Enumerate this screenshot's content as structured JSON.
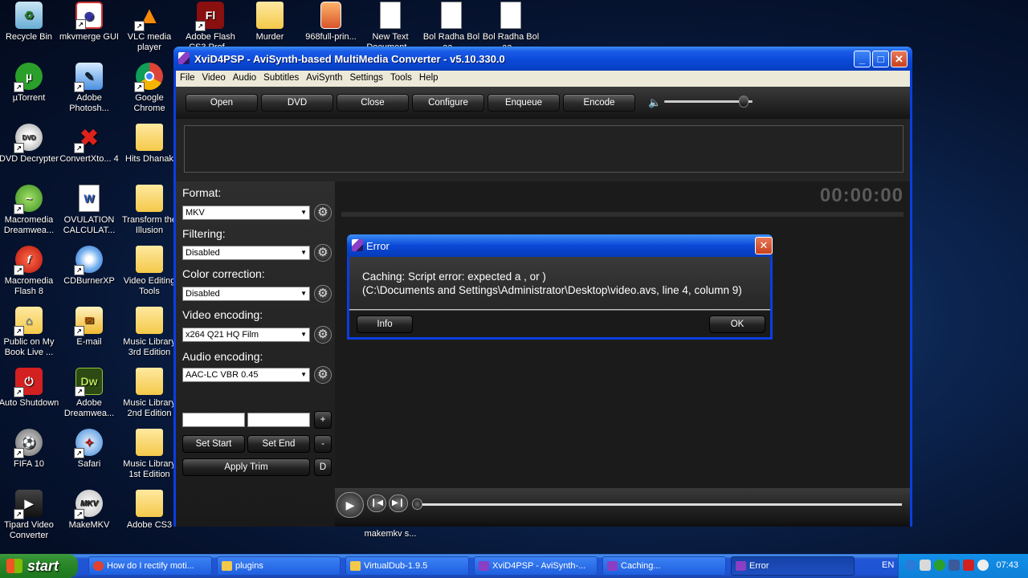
{
  "desktop": {
    "icons": [
      {
        "label": "Recycle Bin",
        "icon": "recycle-bin-icon"
      },
      {
        "label": "mkvmerge GUI",
        "icon": "mkvmerge-icon"
      },
      {
        "label": "VLC media player",
        "icon": "vlc-icon"
      },
      {
        "label": "Adobe Flash CS3 Prof...",
        "icon": "flash-icon"
      },
      {
        "label": "Murder",
        "icon": "folder-icon"
      },
      {
        "label": "968full-prin...",
        "icon": "image-file-icon"
      },
      {
        "label": "New Text Document...",
        "icon": "text-file-icon"
      },
      {
        "label": "Bol Radha Bol aa...",
        "icon": "text-file-icon"
      },
      {
        "label": "Bol Radha Bol aa...",
        "icon": "text-file-icon"
      },
      {
        "label": "µTorrent",
        "icon": "utorrent-icon"
      },
      {
        "label": "Adobe Photosh...",
        "icon": "photoshop-icon"
      },
      {
        "label": "Google Chrome",
        "icon": "chrome-icon"
      },
      {
        "label": "DVD Decrypter",
        "icon": "dvd-icon"
      },
      {
        "label": "ConvertXto... 4",
        "icon": "convertx-icon"
      },
      {
        "label": "Hits Dhanak",
        "icon": "folder-icon"
      },
      {
        "label": "Macromedia Dreamwea...",
        "icon": "dreamweaver-icon"
      },
      {
        "label": "OVULATION CALCULAT...",
        "icon": "word-doc-icon"
      },
      {
        "label": "Transform the Illusion",
        "icon": "folder-icon"
      },
      {
        "label": "Macromedia Flash 8",
        "icon": "flash8-icon"
      },
      {
        "label": "CDBurnerXP",
        "icon": "cdburner-icon"
      },
      {
        "label": "Video Editing Tools",
        "icon": "folder-icon"
      },
      {
        "label": "Public on My Book Live ...",
        "icon": "network-folder-icon"
      },
      {
        "label": "E-mail",
        "icon": "email-icon"
      },
      {
        "label": "Music Library 3rd Edition",
        "icon": "folder-icon"
      },
      {
        "label": "Auto Shutdown",
        "icon": "shutdown-icon"
      },
      {
        "label": "Adobe Dreamwea...",
        "icon": "dw-icon"
      },
      {
        "label": "Music Library 2nd Edition",
        "icon": "folder-icon"
      },
      {
        "label": "FIFA 10",
        "icon": "fifa-icon"
      },
      {
        "label": "Safari",
        "icon": "safari-icon"
      },
      {
        "label": "Music Library 1st Edition",
        "icon": "folder-icon"
      },
      {
        "label": "Tipard Video Converter",
        "icon": "tipard-icon"
      },
      {
        "label": "MakeMKV",
        "icon": "makemkv-icon"
      },
      {
        "label": "Adobe CS3",
        "icon": "folder-icon"
      }
    ],
    "hidden_label": "makemkv s..."
  },
  "window": {
    "title": "XviD4PSP  -  AviSynth-based MultiMedia Converter  -  v5.10.330.0",
    "menu": [
      "File",
      "Video",
      "Audio",
      "Subtitles",
      "AviSynth",
      "Settings",
      "Tools",
      "Help"
    ],
    "toolbar": [
      "Open",
      "DVD",
      "Close",
      "Configure",
      "Enqueue",
      "Encode"
    ],
    "panel": {
      "format_label": "Format:",
      "format_value": "MKV",
      "filtering_label": "Filtering:",
      "filtering_value": "Disabled",
      "color_label": "Color correction:",
      "color_value": "Disabled",
      "video_label": "Video encoding:",
      "video_value": "x264 Q21 HQ Film",
      "audio_label": "Audio encoding:",
      "audio_value": "AAC-LC VBR 0.45",
      "plus": "+",
      "minus": "-",
      "d": "D",
      "set_start": "Set Start",
      "set_end": "Set End",
      "apply_trim": "Apply Trim"
    },
    "timer": "00:00:00",
    "volume_level": 0.9,
    "seek_position": 0.0
  },
  "dialog": {
    "title": "Error",
    "line1": "Caching: Script error: expected a , or )",
    "line2": "(C:\\Documents and Settings\\Administrator\\Desktop\\video.avs, line 4, column 9)",
    "info_button": "Info",
    "ok_button": "OK"
  },
  "taskbar": {
    "start": "start",
    "tasks": [
      {
        "label": "How do I rectify moti...",
        "color": "#e0412f"
      },
      {
        "label": "plugins",
        "color": "#f4c94a"
      },
      {
        "label": "VirtualDub-1.9.5",
        "color": "#f4c94a"
      },
      {
        "label": "XviD4PSP - AviSynth-...",
        "color": "#8a3fc4"
      },
      {
        "label": "Caching...",
        "color": "#8a3fc4"
      },
      {
        "label": "Error",
        "color": "#8a3fc4"
      }
    ],
    "lang": "EN",
    "clock": "07:43"
  }
}
